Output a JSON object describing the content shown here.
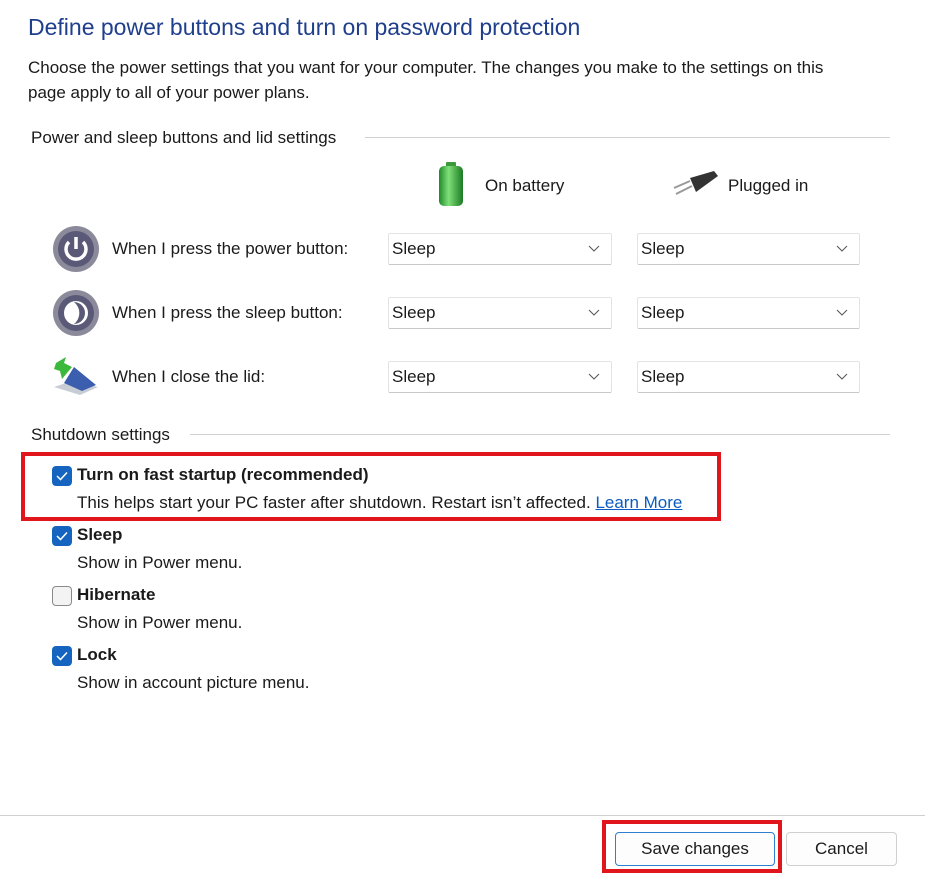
{
  "title": "Define power buttons and turn on password protection",
  "description": [
    "Choose the power settings that you want for your computer. The changes you make to the settings on this",
    "page apply to all of your power plans."
  ],
  "power_section": {
    "heading": "Power and sleep buttons and lid settings",
    "columns": [
      {
        "label": "On battery",
        "icon": "battery-icon"
      },
      {
        "label": "Plugged in",
        "icon": "power-plug-icon"
      }
    ],
    "rows": [
      {
        "label": "When I press the power button:",
        "icon": "power-button-icon",
        "on_battery": "Sleep",
        "plugged_in": "Sleep"
      },
      {
        "label": "When I press the sleep button:",
        "icon": "sleep-button-icon",
        "on_battery": "Sleep",
        "plugged_in": "Sleep"
      },
      {
        "label": "When I close the lid:",
        "icon": "laptop-lid-icon",
        "on_battery": "Sleep",
        "plugged_in": "Sleep"
      }
    ]
  },
  "shutdown_section": {
    "heading": "Shutdown settings",
    "items": [
      {
        "label": "Turn on fast startup (recommended)",
        "description": "This helps start your PC faster after shutdown. Restart isn’t affected.",
        "link": "Learn More",
        "checked": true
      },
      {
        "label": "Sleep",
        "description": "Show in Power menu.",
        "checked": true
      },
      {
        "label": "Hibernate",
        "description": "Show in Power menu.",
        "checked": false
      },
      {
        "label": "Lock",
        "description": "Show in account picture menu.",
        "checked": true
      }
    ]
  },
  "footer": {
    "save": "Save changes",
    "cancel": "Cancel"
  },
  "colors": {
    "title": "#1f3e8c",
    "checkbox": "#1565c0",
    "highlight": "#e0161c",
    "link": "#0b5cbf"
  }
}
